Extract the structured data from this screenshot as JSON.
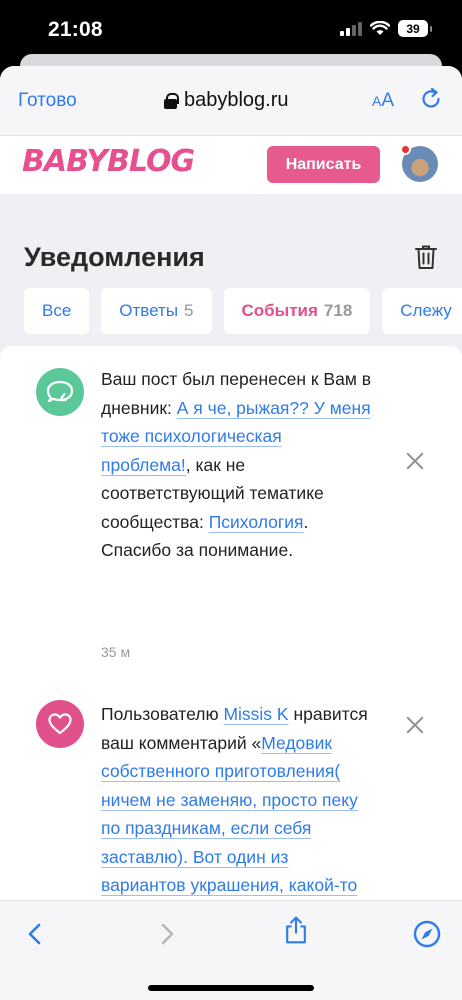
{
  "status_bar": {
    "time": "21:08",
    "battery": "39",
    "icons": [
      "cellular-signal-icon",
      "wifi-icon",
      "battery-icon"
    ]
  },
  "browser": {
    "done_label": "Готово",
    "url": "babyblog.ru",
    "text_size_label_small": "A",
    "text_size_label_large": "A",
    "icons": [
      "lock-icon",
      "reload-icon"
    ]
  },
  "site_header": {
    "logo_text": "BABYBLOG",
    "write_button": "Написать",
    "brand_color": "#e6508e"
  },
  "page": {
    "title": "Уведомления",
    "tabs": [
      {
        "label": "Все",
        "count": ""
      },
      {
        "label": "Ответы",
        "count": "5"
      },
      {
        "label": "События",
        "count": "718"
      },
      {
        "label": "Слежу",
        "count": ""
      }
    ],
    "active_tab": "События"
  },
  "notifications": [
    {
      "icon": "chat-bubble-icon",
      "icon_color": "#5bc89a",
      "text_1": "Ваш пост был перенесен к Вам в дневник: ",
      "link_1": "А я че, рыжая?? У меня тоже психологическая проблема!",
      "text_2": ", как не соответствующий тематике сообщества: ",
      "link_2": "Психология",
      "text_3": ". Спасибо за понимание.",
      "time": "35 м"
    },
    {
      "icon": "heart-icon",
      "icon_color": "#e0508a",
      "text_1": "Пользователю ",
      "link_1": "Missis K",
      "text_2": " нравится ваш комментарий «",
      "link_2": "Медовик собственного приготовления( ничем не заменяю, просто пеку по праздникам, если себя заставлю). Вот один из вариантов украшения, какой-то дурацкий😂😂🙈 , не",
      "text_3": "",
      "time": ""
    }
  ],
  "toolbar": {
    "icons": [
      "back-icon",
      "forward-icon",
      "share-icon",
      "compass-icon"
    ]
  }
}
